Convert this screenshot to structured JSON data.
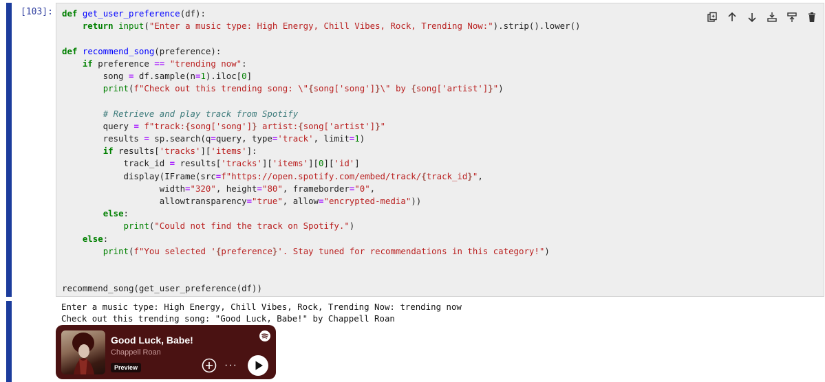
{
  "cell": {
    "prompt": "[103]:",
    "code_lines": [
      "def get_user_preference(df):",
      "    return input(\"Enter a music type: High Energy, Chill Vibes, Rock, Trending Now:\").strip().lower()",
      "",
      "def recommend_song(preference):",
      "    if preference == \"trending now\":",
      "        song = df.sample(n=1).iloc[0]",
      "        print(f\"Check out this trending song: \\\"{song['song']}\\\" by {song['artist']}\")",
      "",
      "        # Retrieve and play track from Spotify",
      "        query = f\"track:{song['song']} artist:{song['artist']}\"",
      "        results = sp.search(q=query, type='track', limit=1)",
      "        if results['tracks']['items']:",
      "            track_id = results['tracks']['items'][0]['id']",
      "            display(IFrame(src=f\"https://open.spotify.com/embed/track/{track_id}\",",
      "                   width=\"320\", height=\"80\", frameborder=\"0\",",
      "                   allowtransparency=\"true\", allow=\"encrypted-media\"))",
      "        else:",
      "            print(\"Could not find the track on Spotify.\")",
      "    else:",
      "        print(f\"You selected '{preference}'. Stay tuned for recommendations in this category!\")",
      "",
      "",
      "recommend_song(get_user_preference(df))"
    ],
    "toolbar": [
      "duplicate-icon",
      "move-up-icon",
      "move-down-icon",
      "insert-above-icon",
      "insert-below-icon",
      "delete-icon"
    ]
  },
  "output": {
    "line1": "Enter a music type: High Energy, Chill Vibes, Rock, Trending Now: trending now",
    "line2": "Check out this trending song: \"Good Luck, Babe!\" by Chappell Roan"
  },
  "spotify": {
    "title": "Good Luck, Babe!",
    "artist": "Chappell Roan",
    "badge": "Preview",
    "more": "···",
    "bg_color": "#4a1212"
  }
}
